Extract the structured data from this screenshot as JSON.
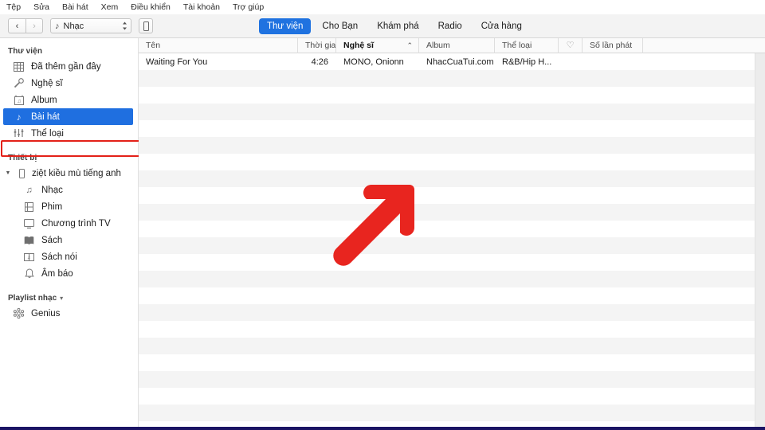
{
  "colors": {
    "accent_blue": "#1f72e0",
    "selection_blue": "#1f6fe0",
    "annotation_red": "#e32119",
    "bottom_bar_navy": "#1b1464"
  },
  "menubar": {
    "items": [
      {
        "label": "Tệp"
      },
      {
        "label": "Sửa"
      },
      {
        "label": "Bài hát"
      },
      {
        "label": "Xem"
      },
      {
        "label": "Điều khiển"
      },
      {
        "label": "Tài khoản"
      },
      {
        "label": "Trợ giúp"
      }
    ]
  },
  "toolbar": {
    "back_label": "‹",
    "forward_label": "›",
    "source_select": {
      "value": "Nhạc",
      "icon": "music-note-icon"
    },
    "device_button_icon": "device-icon",
    "tabs": [
      {
        "label": "Thư viện",
        "active": true
      },
      {
        "label": "Cho Bạn",
        "active": false
      },
      {
        "label": "Khám phá",
        "active": false
      },
      {
        "label": "Radio",
        "active": false
      },
      {
        "label": "Cửa hàng",
        "active": false
      }
    ]
  },
  "sidebar": {
    "library": {
      "header": "Thư viện",
      "items": [
        {
          "label": "Đã thêm gần đây",
          "icon": "grid-icon",
          "selected": false
        },
        {
          "label": "Nghệ sĩ",
          "icon": "microphone-icon",
          "selected": false
        },
        {
          "label": "Album",
          "icon": "album-icon",
          "selected": false
        },
        {
          "label": "Bài hát",
          "icon": "music-note-icon",
          "selected": true
        },
        {
          "label": "Thể loại",
          "icon": "genre-sliders-icon",
          "selected": false
        }
      ]
    },
    "devices": {
      "header": "Thiết bị",
      "device_name": "ziệt kiều mù tiếng anh",
      "device_icon": "device-icon",
      "expand_icon": "triangle-down-icon",
      "items": [
        {
          "label": "Nhạc",
          "icon": "music-note-icon"
        },
        {
          "label": "Phim",
          "icon": "film-icon"
        },
        {
          "label": "Chương trình TV",
          "icon": "tv-icon"
        },
        {
          "label": "Sách",
          "icon": "book-icon"
        },
        {
          "label": "Sách nói",
          "icon": "audiobook-icon"
        },
        {
          "label": "Âm báo",
          "icon": "bell-icon"
        }
      ]
    },
    "playlists": {
      "header": "Playlist nhạc",
      "header_chevron": "chevron-down-icon",
      "items": [
        {
          "label": "Genius",
          "icon": "genius-icon"
        }
      ]
    }
  },
  "table": {
    "columns": [
      {
        "key": "name",
        "label": "Tên",
        "sorted": false
      },
      {
        "key": "time",
        "label": "Thời gian",
        "sorted": false
      },
      {
        "key": "artist",
        "label": "Nghệ sĩ",
        "sorted": true,
        "sort_caret": "⌃"
      },
      {
        "key": "album",
        "label": "Album",
        "sorted": false
      },
      {
        "key": "genre",
        "label": "Thể loại",
        "sorted": false
      },
      {
        "key": "loved",
        "label": "♡",
        "sorted": false
      },
      {
        "key": "plays",
        "label": "Số lần phát",
        "sorted": false
      }
    ],
    "rows": [
      {
        "name": "Waiting For You",
        "time": "4:26",
        "artist": "MONO, Onionn",
        "album": "NhacCuaTui.com",
        "genre": "R&B/Hip H...",
        "loved": "",
        "plays": ""
      }
    ],
    "empty_row_count": 21
  },
  "annotations": {
    "arrow": {
      "name": "red-arrow-pointing-up-right",
      "color": "#e32119"
    },
    "highlight_box": {
      "name": "red-highlight-around-bai-hat",
      "color": "#e32119"
    }
  }
}
